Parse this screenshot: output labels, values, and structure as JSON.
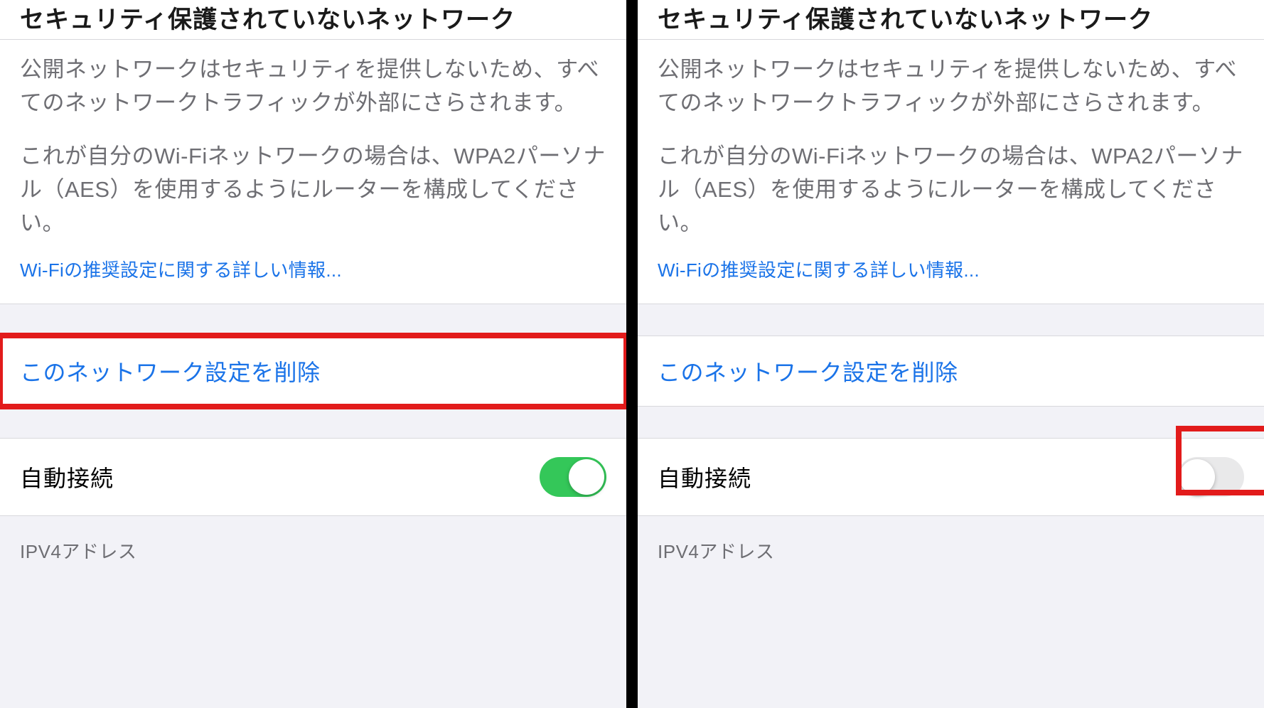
{
  "header_partial": "セキュリティ保護されていないネットワーク",
  "info": {
    "paragraph1": "公開ネットワークはセキュリティを提供しないため、すべてのネットワークトラフィックが外部にさらされます。",
    "paragraph2": "これが自分のWi-Fiネットワークの場合は、WPA2パーソナル（AES）を使用するようにルーターを構成してください。",
    "link": "Wi-Fiの推奨設定に関する詳しい情報..."
  },
  "actions": {
    "forget_network": "このネットワーク設定を削除"
  },
  "toggles": {
    "auto_join_label": "自動接続",
    "left_state": "on",
    "right_state": "off"
  },
  "sections": {
    "ipv4": "IPV4アドレス"
  },
  "colors": {
    "link": "#1a73e8",
    "toggle_on": "#34c759",
    "highlight": "#e21b1b"
  }
}
